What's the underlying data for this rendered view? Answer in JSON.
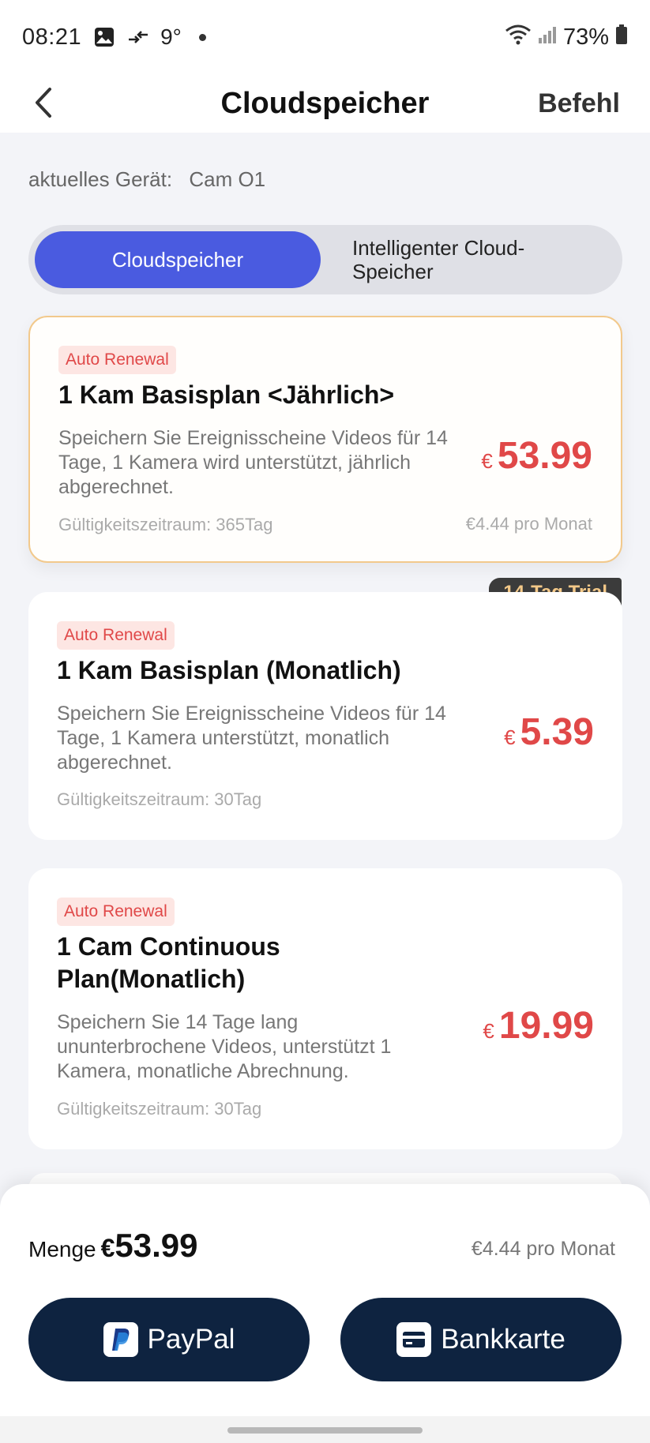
{
  "status_bar": {
    "time": "08:21",
    "temperature": "9°",
    "battery": "73%",
    "icons": [
      "gallery-icon",
      "data-transfer-icon",
      "wifi-icon",
      "signal-icon",
      "battery-icon"
    ]
  },
  "header": {
    "title": "Cloudspeicher",
    "action_label": "Befehl"
  },
  "device": {
    "label": "aktuelles Gerät:",
    "name": "Cam O1"
  },
  "tabs": [
    {
      "label": "Cloudspeicher",
      "active": true
    },
    {
      "label": "Intelligenter Cloud-Speicher",
      "active": false
    }
  ],
  "plans": [
    {
      "badge": "Auto Renewal",
      "title": "1 Kam Basisplan <Jährlich>",
      "description": "Speichern Sie Ereignisscheine Videos für 14 Tage, 1 Kamera wird unterstützt, jährlich abgerechnet.",
      "validity": "Gültigkeitszeitraum: 365Tag",
      "currency": "€",
      "price": "53.99",
      "per_month": "€4.44 pro Monat",
      "selected": true
    },
    {
      "badge": "Auto Renewal",
      "tag": "14-Tag Trial",
      "title": "1 Kam Basisplan (Monatlich)",
      "description": "Speichern Sie Ereignisscheine Videos für 14 Tage, 1 Kamera unterstützt, monatlich abgerechnet.",
      "validity": "Gültigkeitszeitraum: 30Tag",
      "currency": "€",
      "price": "5.39",
      "selected": false
    },
    {
      "badge": "Auto Renewal",
      "title": "1 Cam Continuous Plan(Monatlich)",
      "description": "Speichern Sie 14 Tage lang ununterbrochene Videos, unterstützt 1 Kamera, monatliche Abrechnung.",
      "validity": "Gültigkeitszeitraum: 30Tag",
      "currency": "€",
      "price": "19.99",
      "selected": false
    }
  ],
  "summary": {
    "label": "Menge",
    "currency": "€",
    "amount": "53.99",
    "per_month": "€4.44 pro Monat"
  },
  "buttons": {
    "paypal": "PayPal",
    "bank": "Bankkarte"
  },
  "colors": {
    "accent": "#4a5be0",
    "price": "#e04848",
    "button_bg": "#0e2340",
    "trial_tag_bg": "#3b3b3b",
    "trial_tag_text": "#f3c888",
    "selected_border": "#f2c98c"
  }
}
